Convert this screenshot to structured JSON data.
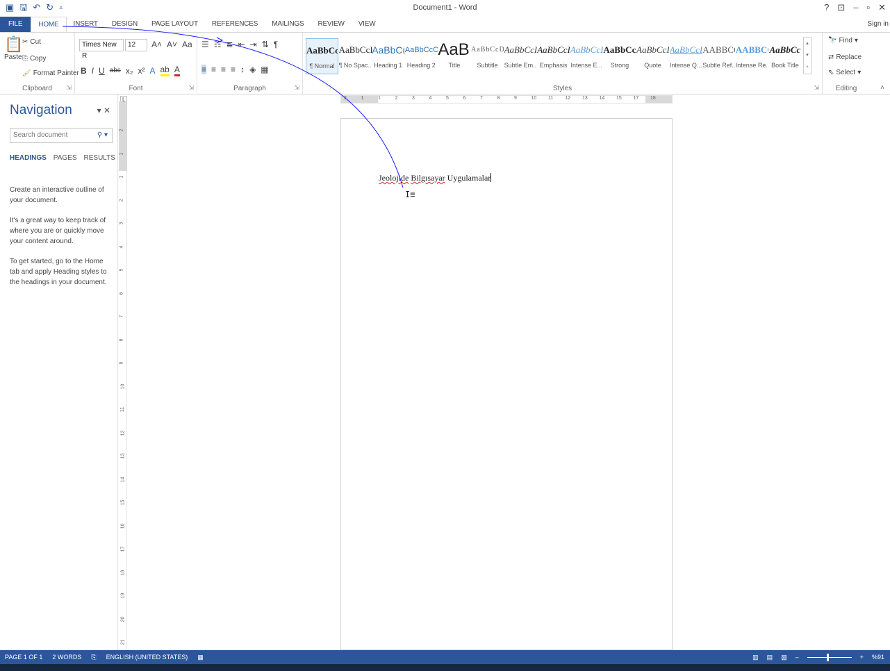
{
  "app": {
    "title": "Document1 - Word",
    "window_buttons": [
      "?",
      "⊡",
      "–",
      "🗗",
      "✕"
    ],
    "sign_in": "Sign in"
  },
  "ribbon_tabs": [
    "FILE",
    "HOME",
    "INSERT",
    "DESIGN",
    "PAGE LAYOUT",
    "REFERENCES",
    "MAILINGS",
    "REVIEW",
    "VIEW"
  ],
  "active_tab": "HOME",
  "clipboard": {
    "label": "Clipboard",
    "paste": "Paste",
    "cut": "Cut",
    "copy": "Copy",
    "format_painter": "Format Painter"
  },
  "font": {
    "label": "Font",
    "name": "Times New R",
    "size": "12"
  },
  "paragraph": {
    "label": "Paragraph"
  },
  "styles": {
    "label": "Styles",
    "items": [
      {
        "preview": "AaBbCcI",
        "name": "¶ Normal"
      },
      {
        "preview": "AaBbCcI",
        "name": "¶ No Spac..."
      },
      {
        "preview": "AaBbC(",
        "name": "Heading 1"
      },
      {
        "preview": "AaBbCcC",
        "name": "Heading 2"
      },
      {
        "preview": "AaB|",
        "name": "Title"
      },
      {
        "preview": "AaBbCcD",
        "name": "Subtitle"
      },
      {
        "preview": "AaBbCcI",
        "name": "Subtle Em..."
      },
      {
        "preview": "AaBbCcI",
        "name": "Emphasis"
      },
      {
        "preview": "AaBbCcI",
        "name": "Intense E..."
      },
      {
        "preview": "AaBbCcl",
        "name": "Strong"
      },
      {
        "preview": "AaBbCcI",
        "name": "Quote"
      },
      {
        "preview": "AaBbCcI",
        "name": "Intense Q..."
      },
      {
        "preview": "AABBCC",
        "name": "Subtle Ref..."
      },
      {
        "preview": "AABBCC",
        "name": "Intense Re..."
      },
      {
        "preview": "AaBbCc",
        "name": "Book Title"
      }
    ]
  },
  "editing": {
    "label": "Editing",
    "find": "Find",
    "replace": "Replace",
    "select": "Select"
  },
  "navigation": {
    "title": "Navigation",
    "search_placeholder": "Search document",
    "tabs": [
      "HEADINGS",
      "PAGES",
      "RESULTS"
    ],
    "para1": "Create an interactive outline of your document.",
    "para2": "It's a great way to keep track of where you are or quickly move your content around.",
    "para3": "To get started, go to the Home tab and apply Heading styles to the headings in your document."
  },
  "document": {
    "word1": "Jeolojide",
    "word2": "Bilgısayar",
    "word3": "Uygulamalar"
  },
  "ruler": {
    "horizontal": [
      "2",
      "1",
      "1",
      "2",
      "3",
      "4",
      "5",
      "6",
      "7",
      "8",
      "9",
      "10",
      "11",
      "12",
      "13",
      "14",
      "15",
      "17",
      "18"
    ],
    "vertical": [
      "2",
      "1",
      "1",
      "2",
      "3",
      "4",
      "5",
      "6",
      "7",
      "8",
      "9",
      "10",
      "11",
      "12",
      "13",
      "14",
      "15",
      "16",
      "17",
      "18",
      "19",
      "20",
      "21"
    ]
  },
  "status": {
    "page": "PAGE 1 OF 1",
    "words": "2 WORDS",
    "language": "ENGLISH (UNITED STATES)",
    "zoom": "%91"
  },
  "colors": {
    "accent": "#2b579a",
    "annotation_curve": "#1a1aff",
    "spell_error": "#dd2222"
  }
}
